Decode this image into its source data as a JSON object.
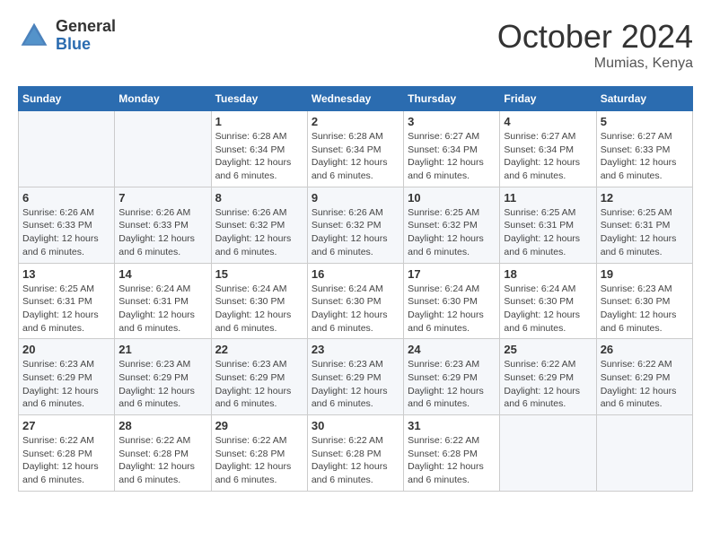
{
  "header": {
    "logo_line1": "General",
    "logo_line2": "Blue",
    "month_title": "October 2024",
    "location": "Mumias, Kenya"
  },
  "days_of_week": [
    "Sunday",
    "Monday",
    "Tuesday",
    "Wednesday",
    "Thursday",
    "Friday",
    "Saturday"
  ],
  "weeks": [
    [
      {
        "day": "",
        "info": ""
      },
      {
        "day": "",
        "info": ""
      },
      {
        "day": "1",
        "info": "Sunrise: 6:28 AM\nSunset: 6:34 PM\nDaylight: 12 hours and 6 minutes."
      },
      {
        "day": "2",
        "info": "Sunrise: 6:28 AM\nSunset: 6:34 PM\nDaylight: 12 hours and 6 minutes."
      },
      {
        "day": "3",
        "info": "Sunrise: 6:27 AM\nSunset: 6:34 PM\nDaylight: 12 hours and 6 minutes."
      },
      {
        "day": "4",
        "info": "Sunrise: 6:27 AM\nSunset: 6:34 PM\nDaylight: 12 hours and 6 minutes."
      },
      {
        "day": "5",
        "info": "Sunrise: 6:27 AM\nSunset: 6:33 PM\nDaylight: 12 hours and 6 minutes."
      }
    ],
    [
      {
        "day": "6",
        "info": "Sunrise: 6:26 AM\nSunset: 6:33 PM\nDaylight: 12 hours and 6 minutes."
      },
      {
        "day": "7",
        "info": "Sunrise: 6:26 AM\nSunset: 6:33 PM\nDaylight: 12 hours and 6 minutes."
      },
      {
        "day": "8",
        "info": "Sunrise: 6:26 AM\nSunset: 6:32 PM\nDaylight: 12 hours and 6 minutes."
      },
      {
        "day": "9",
        "info": "Sunrise: 6:26 AM\nSunset: 6:32 PM\nDaylight: 12 hours and 6 minutes."
      },
      {
        "day": "10",
        "info": "Sunrise: 6:25 AM\nSunset: 6:32 PM\nDaylight: 12 hours and 6 minutes."
      },
      {
        "day": "11",
        "info": "Sunrise: 6:25 AM\nSunset: 6:31 PM\nDaylight: 12 hours and 6 minutes."
      },
      {
        "day": "12",
        "info": "Sunrise: 6:25 AM\nSunset: 6:31 PM\nDaylight: 12 hours and 6 minutes."
      }
    ],
    [
      {
        "day": "13",
        "info": "Sunrise: 6:25 AM\nSunset: 6:31 PM\nDaylight: 12 hours and 6 minutes."
      },
      {
        "day": "14",
        "info": "Sunrise: 6:24 AM\nSunset: 6:31 PM\nDaylight: 12 hours and 6 minutes."
      },
      {
        "day": "15",
        "info": "Sunrise: 6:24 AM\nSunset: 6:30 PM\nDaylight: 12 hours and 6 minutes."
      },
      {
        "day": "16",
        "info": "Sunrise: 6:24 AM\nSunset: 6:30 PM\nDaylight: 12 hours and 6 minutes."
      },
      {
        "day": "17",
        "info": "Sunrise: 6:24 AM\nSunset: 6:30 PM\nDaylight: 12 hours and 6 minutes."
      },
      {
        "day": "18",
        "info": "Sunrise: 6:24 AM\nSunset: 6:30 PM\nDaylight: 12 hours and 6 minutes."
      },
      {
        "day": "19",
        "info": "Sunrise: 6:23 AM\nSunset: 6:30 PM\nDaylight: 12 hours and 6 minutes."
      }
    ],
    [
      {
        "day": "20",
        "info": "Sunrise: 6:23 AM\nSunset: 6:29 PM\nDaylight: 12 hours and 6 minutes."
      },
      {
        "day": "21",
        "info": "Sunrise: 6:23 AM\nSunset: 6:29 PM\nDaylight: 12 hours and 6 minutes."
      },
      {
        "day": "22",
        "info": "Sunrise: 6:23 AM\nSunset: 6:29 PM\nDaylight: 12 hours and 6 minutes."
      },
      {
        "day": "23",
        "info": "Sunrise: 6:23 AM\nSunset: 6:29 PM\nDaylight: 12 hours and 6 minutes."
      },
      {
        "day": "24",
        "info": "Sunrise: 6:23 AM\nSunset: 6:29 PM\nDaylight: 12 hours and 6 minutes."
      },
      {
        "day": "25",
        "info": "Sunrise: 6:22 AM\nSunset: 6:29 PM\nDaylight: 12 hours and 6 minutes."
      },
      {
        "day": "26",
        "info": "Sunrise: 6:22 AM\nSunset: 6:29 PM\nDaylight: 12 hours and 6 minutes."
      }
    ],
    [
      {
        "day": "27",
        "info": "Sunrise: 6:22 AM\nSunset: 6:28 PM\nDaylight: 12 hours and 6 minutes."
      },
      {
        "day": "28",
        "info": "Sunrise: 6:22 AM\nSunset: 6:28 PM\nDaylight: 12 hours and 6 minutes."
      },
      {
        "day": "29",
        "info": "Sunrise: 6:22 AM\nSunset: 6:28 PM\nDaylight: 12 hours and 6 minutes."
      },
      {
        "day": "30",
        "info": "Sunrise: 6:22 AM\nSunset: 6:28 PM\nDaylight: 12 hours and 6 minutes."
      },
      {
        "day": "31",
        "info": "Sunrise: 6:22 AM\nSunset: 6:28 PM\nDaylight: 12 hours and 6 minutes."
      },
      {
        "day": "",
        "info": ""
      },
      {
        "day": "",
        "info": ""
      }
    ]
  ]
}
